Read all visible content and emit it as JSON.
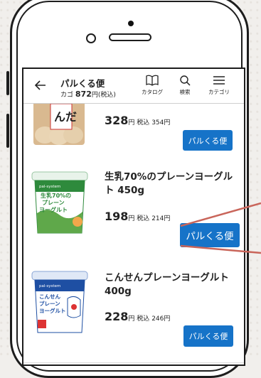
{
  "header": {
    "title": "パルくる便",
    "cart_label": "カゴ",
    "cart_amount": "872",
    "cart_suffix": "円(税込)",
    "nav": [
      {
        "label": "カタログ",
        "icon": "book-icon"
      },
      {
        "label": "検索",
        "icon": "search-icon"
      },
      {
        "label": "カテゴリ",
        "icon": "menu-icon"
      }
    ]
  },
  "products": [
    {
      "name": "",
      "price": "328",
      "yen": "円",
      "tax_label": "税込",
      "tax_price": "354円",
      "button": "パルくる便",
      "package_text": "んだ"
    },
    {
      "name": "生乳70%のプレーンヨーグルト 450g",
      "price": "198",
      "yen": "円",
      "tax_label": "税込",
      "tax_price": "214円",
      "button": "パルくる便",
      "package_brand": "pal-system",
      "package_line1": "生乳70%の",
      "package_line2": "プレーン",
      "package_line3": "ヨーグルト"
    },
    {
      "name": "こんせんプレーンヨーグルト 400g",
      "price": "228",
      "yen": "円",
      "tax_label": "税込",
      "tax_price": "246円",
      "button": "パルくる便",
      "package_brand": "pal-system",
      "package_line1": "こんせん",
      "package_line2": "プレーン",
      "package_line3": "ヨーグルト"
    }
  ],
  "colors": {
    "accent": "#1673c8",
    "callout": "#c9655a",
    "pkg_green": "#2e8a3c",
    "pkg_blue": "#1e4fa3"
  }
}
